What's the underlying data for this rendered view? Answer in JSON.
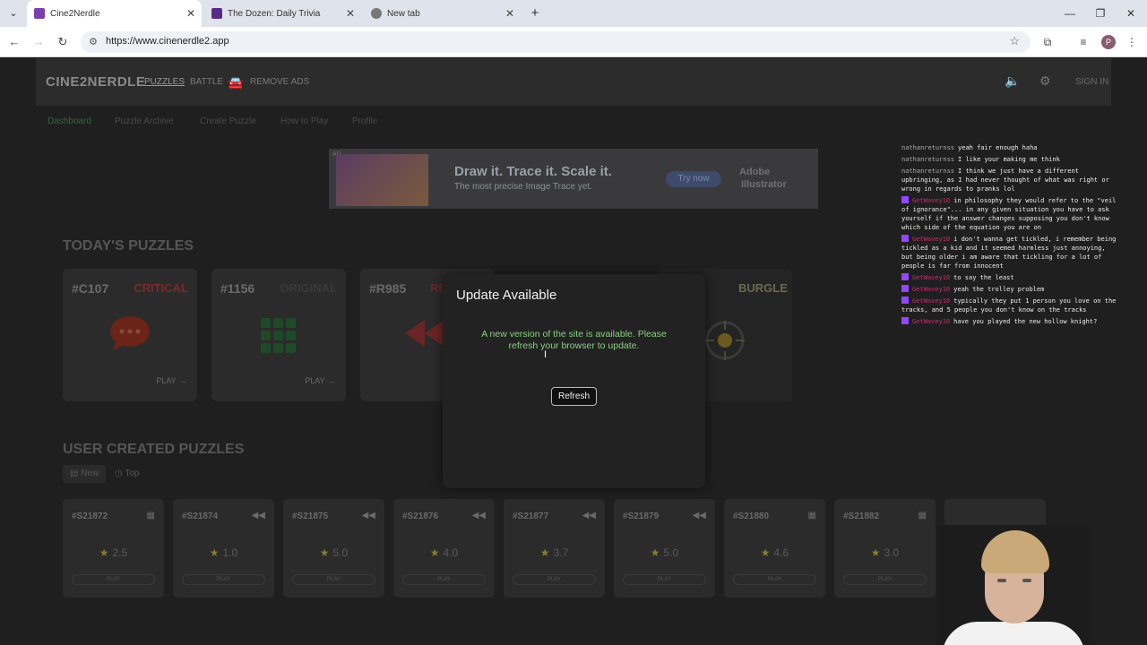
{
  "browser": {
    "tabs": [
      {
        "label": "Cine2Nerdle",
        "active": true,
        "favicon_color": "#7a3fa8"
      },
      {
        "label": "The Dozen: Daily Trivia",
        "active": false,
        "favicon_color": "#5b2a86"
      },
      {
        "label": "New tab",
        "active": false,
        "favicon_color": "#777777"
      }
    ],
    "url": "https://www.cinenerdle2.app",
    "profile_initial": "P"
  },
  "site": {
    "logo": "CINE2NERDLE",
    "nav": {
      "puzzles": "PUZZLES",
      "battle": "BATTLE",
      "remove_ads": "REMOVE ADS",
      "sign_in": "SIGN IN"
    },
    "subnav": [
      "Dashboard",
      "Puzzle Archive",
      "Create Puzzle",
      "How to Play",
      "Profile"
    ]
  },
  "ad": {
    "headline": "Draw it. Trace it. Scale it.",
    "subline": "The most precise Image Trace yet.",
    "cta": "Try now",
    "brand_line1": "Adobe",
    "brand_line2": "Illustrator",
    "mark": "AD"
  },
  "todays_puzzles": {
    "title": "TODAY'S PUZZLES",
    "cards": [
      {
        "number": "#C107",
        "tag": "CRITICAL",
        "tag_color": "#7a2b2b",
        "play": "PLAY"
      },
      {
        "number": "#1156",
        "tag": "ORIGINAL",
        "tag_color": "#3a3a3a",
        "play": "PLAY"
      },
      {
        "number": "#R985",
        "tag": "RE",
        "tag_color": "#6a2a2a",
        "play": ""
      },
      {
        "number": "",
        "tag": "BURGLE",
        "tag_color": "#6a6a50",
        "play": ""
      }
    ]
  },
  "user_puzzles": {
    "title": "USER CREATED PUZZLES",
    "filters": [
      "New",
      "Top"
    ],
    "cards": [
      {
        "number": "#S21872",
        "rating": "2.5",
        "play": "PLAY"
      },
      {
        "number": "#S21874",
        "rating": "1.0",
        "play": "PLAY"
      },
      {
        "number": "#S21875",
        "rating": "5.0",
        "play": "PLAY"
      },
      {
        "number": "#S21876",
        "rating": "4.0",
        "play": "PLAY"
      },
      {
        "number": "#S21877",
        "rating": "3.7",
        "play": "PLAY"
      },
      {
        "number": "#S21879",
        "rating": "5.0",
        "play": "PLAY"
      },
      {
        "number": "#S21880",
        "rating": "4.6",
        "play": "PLAY"
      },
      {
        "number": "#S21882",
        "rating": "3.0",
        "play": "PLAY"
      }
    ]
  },
  "modal": {
    "title": "Update Available",
    "message": "A new version of the site is available. Please refresh your browser to update.",
    "button": "Refresh",
    "message_color": "#8acf80"
  },
  "chat": [
    {
      "user": "nathanreturnss",
      "badge": false,
      "text": "yeah fair enough haha"
    },
    {
      "user": "nathanreturnss",
      "badge": false,
      "text": "I like your making me think"
    },
    {
      "user": "nathanreturnss",
      "badge": false,
      "text": "I think we just have a different upbringing, as I had never thought of what was right or wrong in regards to pranks lol"
    },
    {
      "user": "GetWavey10",
      "badge": true,
      "text": "in philosophy they would refer to the \"veil of ignorance\"... in any given situation you have to ask yourself if the answer changes supposing you don't know which side of the equation you are on"
    },
    {
      "user": "GetWavey10",
      "badge": true,
      "text": "i don't wanna get tickled, i remember being tickled as a kid and it seemed harmless just annoying, but being older i am aware that tickling for a lot of people is far from innocent"
    },
    {
      "user": "GetWavey10",
      "badge": true,
      "text": "to say the least"
    },
    {
      "user": "GetWavey10",
      "badge": true,
      "text": "yeah the trolley problem"
    },
    {
      "user": "GetWavey10",
      "badge": true,
      "text": "typically they put 1 person you love on the tracks, and 5 people you don't know on the tracks"
    },
    {
      "user": "GetWavey10",
      "badge": true,
      "text": "have you played the new hollow knight?"
    }
  ]
}
